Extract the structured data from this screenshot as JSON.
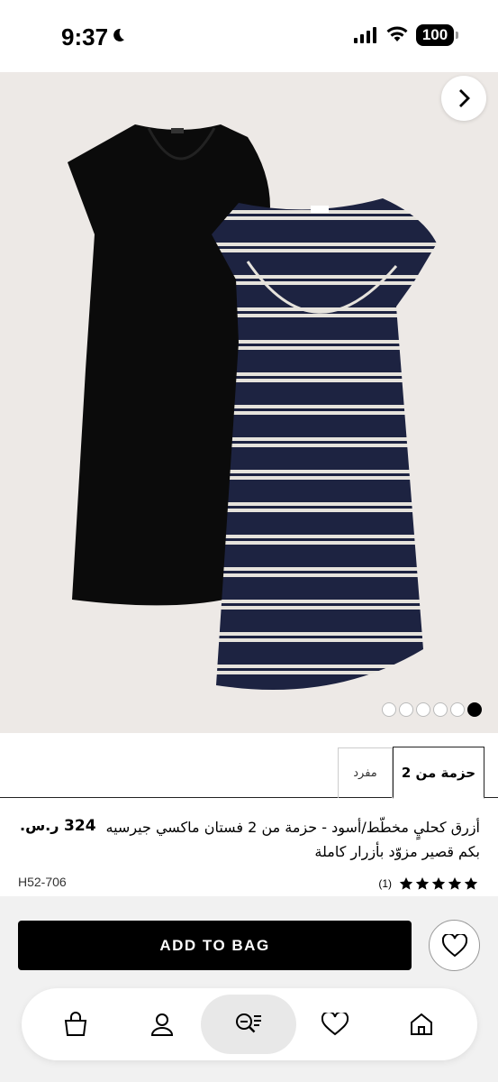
{
  "status_bar": {
    "time": "9:37",
    "battery": "100"
  },
  "gallery": {
    "page_count": 6,
    "active_index": 5
  },
  "tabs": {
    "pack": "حزمة من 2",
    "single": "مفرد"
  },
  "product": {
    "title": "أزرق كحليٍ مخطّط/أسود - حزمة من 2 فستان ماكسي جيرسيه بكم قصير مزوّد بأزرار كاملة",
    "price": "324",
    "currency": "ر.س.",
    "sku": "H52-706",
    "rating_count": "(1)",
    "rating_stars": 5
  },
  "actions": {
    "add_to_bag": "ADD TO BAG"
  },
  "nav": {
    "items": [
      "bag-icon",
      "account-icon",
      "search-icon",
      "favourites-icon",
      "home-icon"
    ],
    "active": "search-icon"
  },
  "colors": {
    "accent": "#000000",
    "background_panel": "#f1f1f1",
    "gallery_bg": "#ede9e6",
    "navy": "#1d2341"
  }
}
